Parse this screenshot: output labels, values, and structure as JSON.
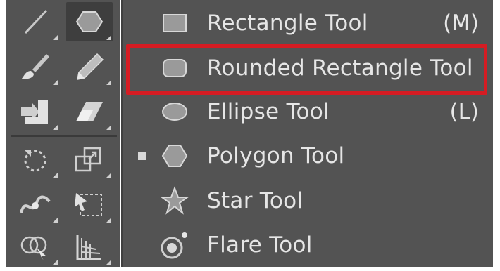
{
  "toolbar": {
    "tools": [
      {
        "left_icon": "line-segment-icon",
        "right_icon": "polygon-icon",
        "right_selected": true
      },
      {
        "left_icon": "paintbrush-icon",
        "right_icon": "pencil-icon"
      },
      {
        "left_icon": "shaper-icon",
        "right_icon": "eraser-icon"
      },
      {
        "left_icon": "rotate-icon",
        "right_icon": "scale-icon"
      },
      {
        "left_icon": "width-icon",
        "right_icon": "free-transform-icon"
      },
      {
        "left_icon": "shape-builder-icon",
        "right_icon": "perspective-grid-icon"
      }
    ]
  },
  "menu": {
    "items": [
      {
        "label": "Rectangle Tool",
        "shortcut": "(M)",
        "icon": "rectangle-icon",
        "active": false,
        "highlighted": false
      },
      {
        "label": "Rounded Rectangle Tool",
        "shortcut": "",
        "icon": "rounded-rectangle-icon",
        "active": false,
        "highlighted": true
      },
      {
        "label": "Ellipse Tool",
        "shortcut": "(L)",
        "icon": "ellipse-icon",
        "active": false,
        "highlighted": false
      },
      {
        "label": "Polygon Tool",
        "shortcut": "",
        "icon": "polygon-icon",
        "active": true,
        "highlighted": false
      },
      {
        "label": "Star Tool",
        "shortcut": "",
        "icon": "star-icon",
        "active": false,
        "highlighted": false
      },
      {
        "label": "Flare Tool",
        "shortcut": "",
        "icon": "flare-icon",
        "active": false,
        "highlighted": false
      }
    ]
  },
  "colors": {
    "panel": "#535353",
    "text": "#e6e6e6",
    "highlight": "#d51c23"
  }
}
